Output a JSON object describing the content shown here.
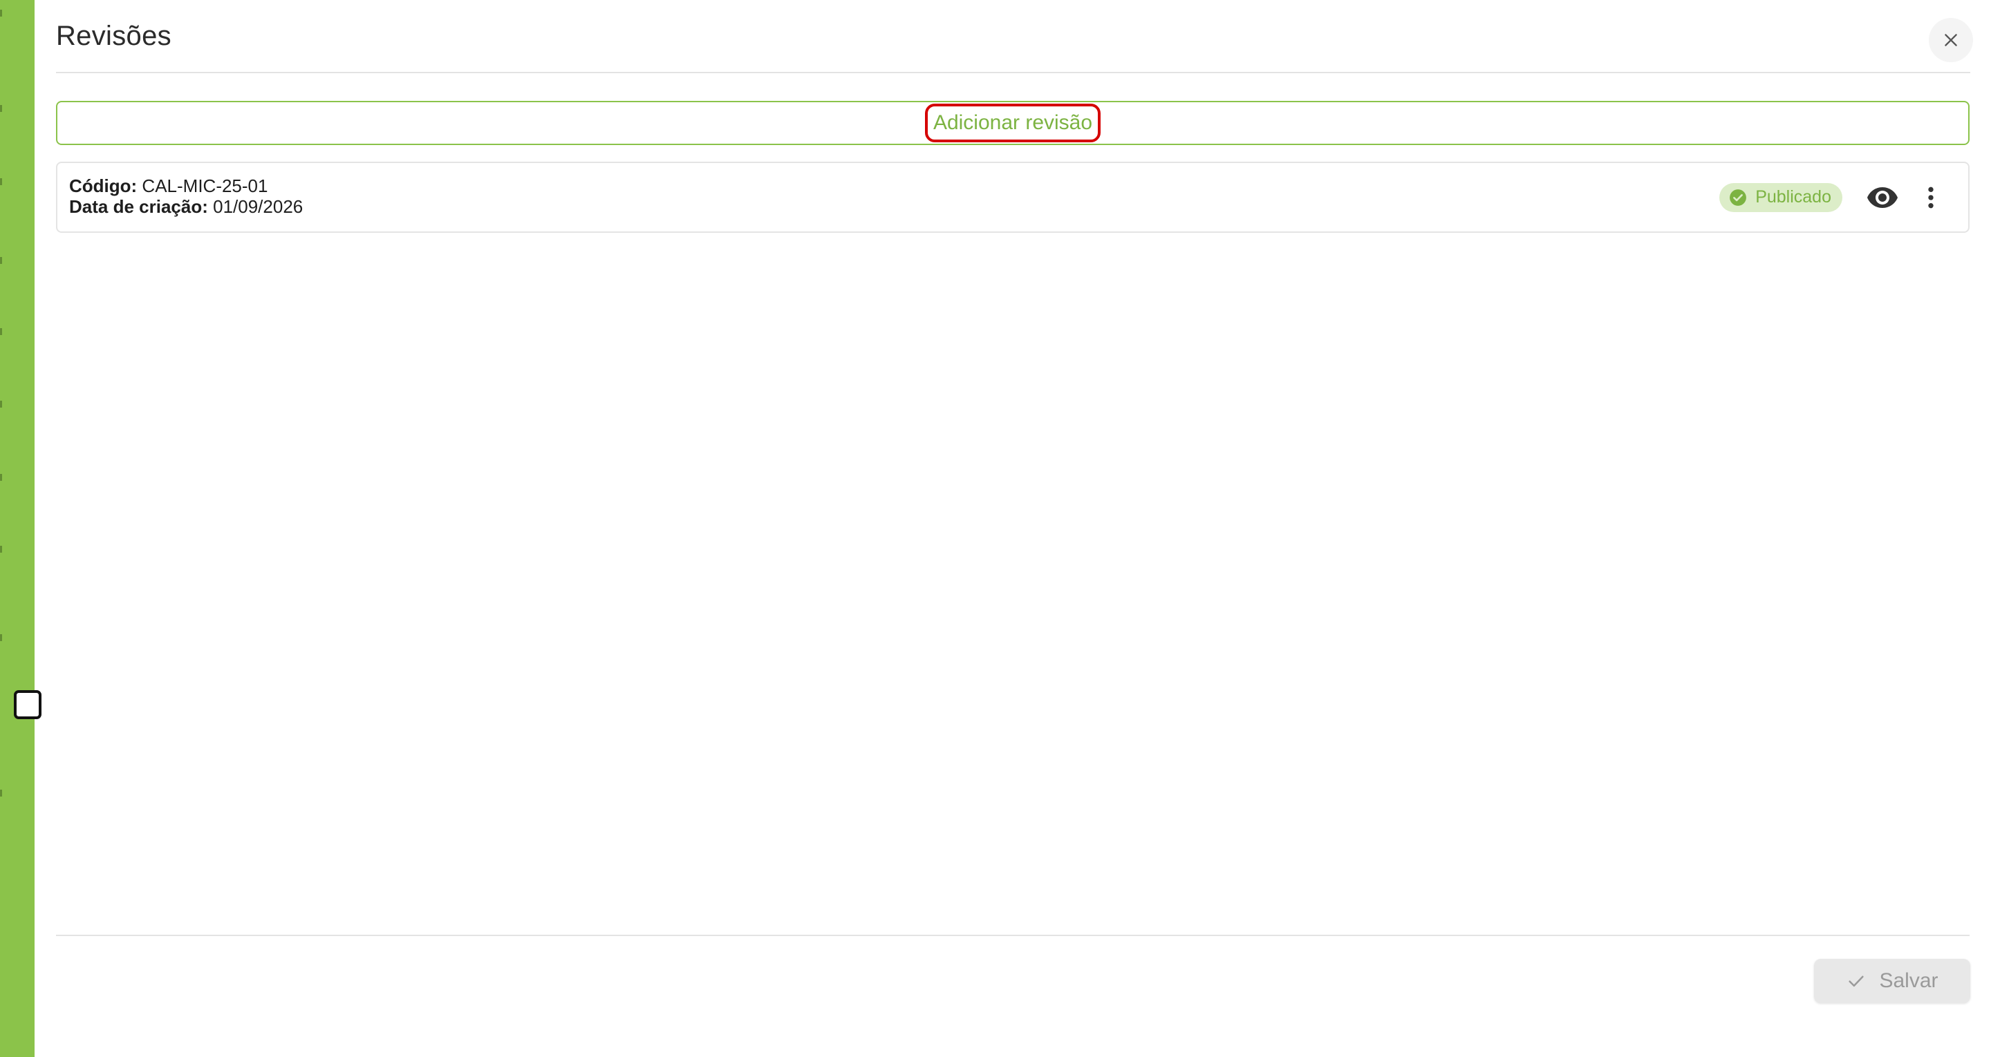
{
  "dialog": {
    "title": "Revisões",
    "close_icon": "close-icon",
    "add_revision_label": "Adicionar revisão",
    "revisions": [
      {
        "code_label": "Código:",
        "code_value": "CAL-MIC-25-01",
        "date_label": "Data de criação:",
        "date_value": "01/09/2026",
        "status": "Publicado",
        "status_icon": "check-circle-icon",
        "view_icon": "eye-icon",
        "menu_icon": "more-vertical-icon"
      }
    ],
    "save_label": "Salvar",
    "save_icon": "check-icon",
    "save_disabled": true
  },
  "colors": {
    "accent_green": "#8bc34a",
    "accent_green_text": "#7cb342",
    "badge_bg": "#dcedc8",
    "highlight_red": "#d50000"
  }
}
